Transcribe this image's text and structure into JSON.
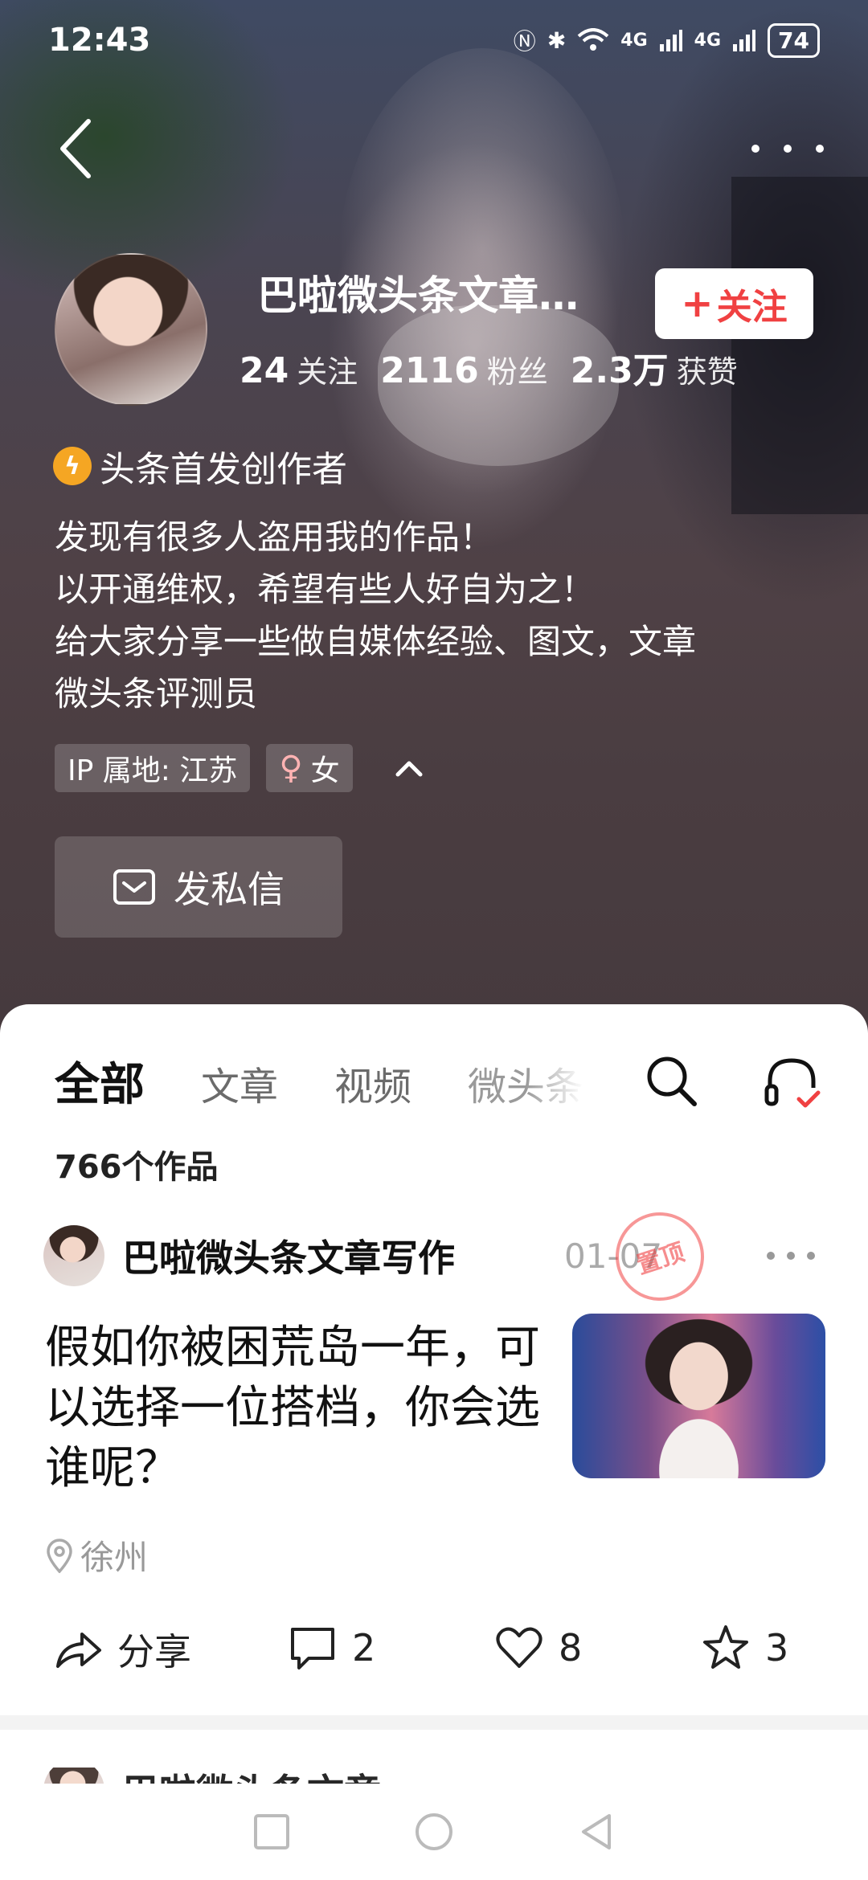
{
  "status_bar": {
    "time": "12:43",
    "signal1": "4G",
    "signal2": "4G",
    "battery": "74"
  },
  "profile": {
    "name": "巴啦微头条文章写作",
    "follow_label": "关注",
    "stats": [
      {
        "num": "24",
        "label": "关注"
      },
      {
        "num": "2116",
        "label": "粉丝"
      },
      {
        "num": "2.3万",
        "label": "获赞"
      }
    ],
    "creator_badge": "头条首发创作者",
    "bio": [
      "发现有很多人盗用我的作品！",
      "以开通维权，希望有些人好自为之！",
      "给大家分享一些做自媒体经验、图文，文章",
      "微头条评测员"
    ],
    "tags": {
      "ip": "IP 属地: 江苏",
      "gender_symbol": "♀",
      "gender": "女"
    },
    "dm_label": "发私信"
  },
  "tabs": [
    {
      "label": "全部",
      "active": true
    },
    {
      "label": "文章"
    },
    {
      "label": "视频"
    },
    {
      "label": "微头条"
    }
  ],
  "works_count": "766个作品",
  "post": {
    "author": "巴啦微头条文章写作",
    "date": "01-07",
    "pinned": "置顶",
    "title": "假如你被困荒岛一年，可以选择一位搭档，你会选谁呢？",
    "location": "徐州",
    "actions": {
      "share": "分享",
      "comments": "2",
      "likes": "8",
      "favorites": "3"
    }
  },
  "next_post": {
    "author": "巴啦微头条文章"
  },
  "icons": {
    "back": "back-arrow-icon",
    "more": "more-dots-icon",
    "search": "search-icon",
    "headset": "headset-icon",
    "location": "location-pin-icon",
    "share": "share-icon",
    "comment": "comment-icon",
    "like": "heart-icon",
    "favorite": "star-icon"
  },
  "colors": {
    "accent": "#f04142",
    "badge": "#f5a623"
  }
}
